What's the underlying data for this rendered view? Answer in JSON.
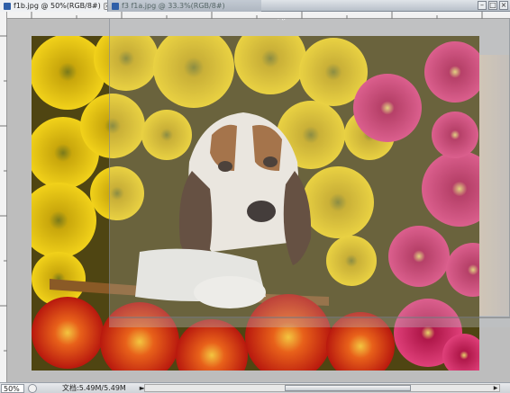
{
  "tabs": [
    {
      "label": "f1b.jpg @ 50%(RGB/8#)",
      "close": "×"
    },
    {
      "label": "f3 f1a.jpg @ 33.3%(RGB/8#)"
    }
  ],
  "window_controls": [
    "–",
    "□",
    "×"
  ],
  "status": {
    "zoom": "50%",
    "doc_info": "文档:5.49M/5.49M",
    "arrow": "►"
  },
  "icons": {
    "tab_app": "photoshop-document-icon",
    "cursor": "mouse-pointer-icon"
  }
}
